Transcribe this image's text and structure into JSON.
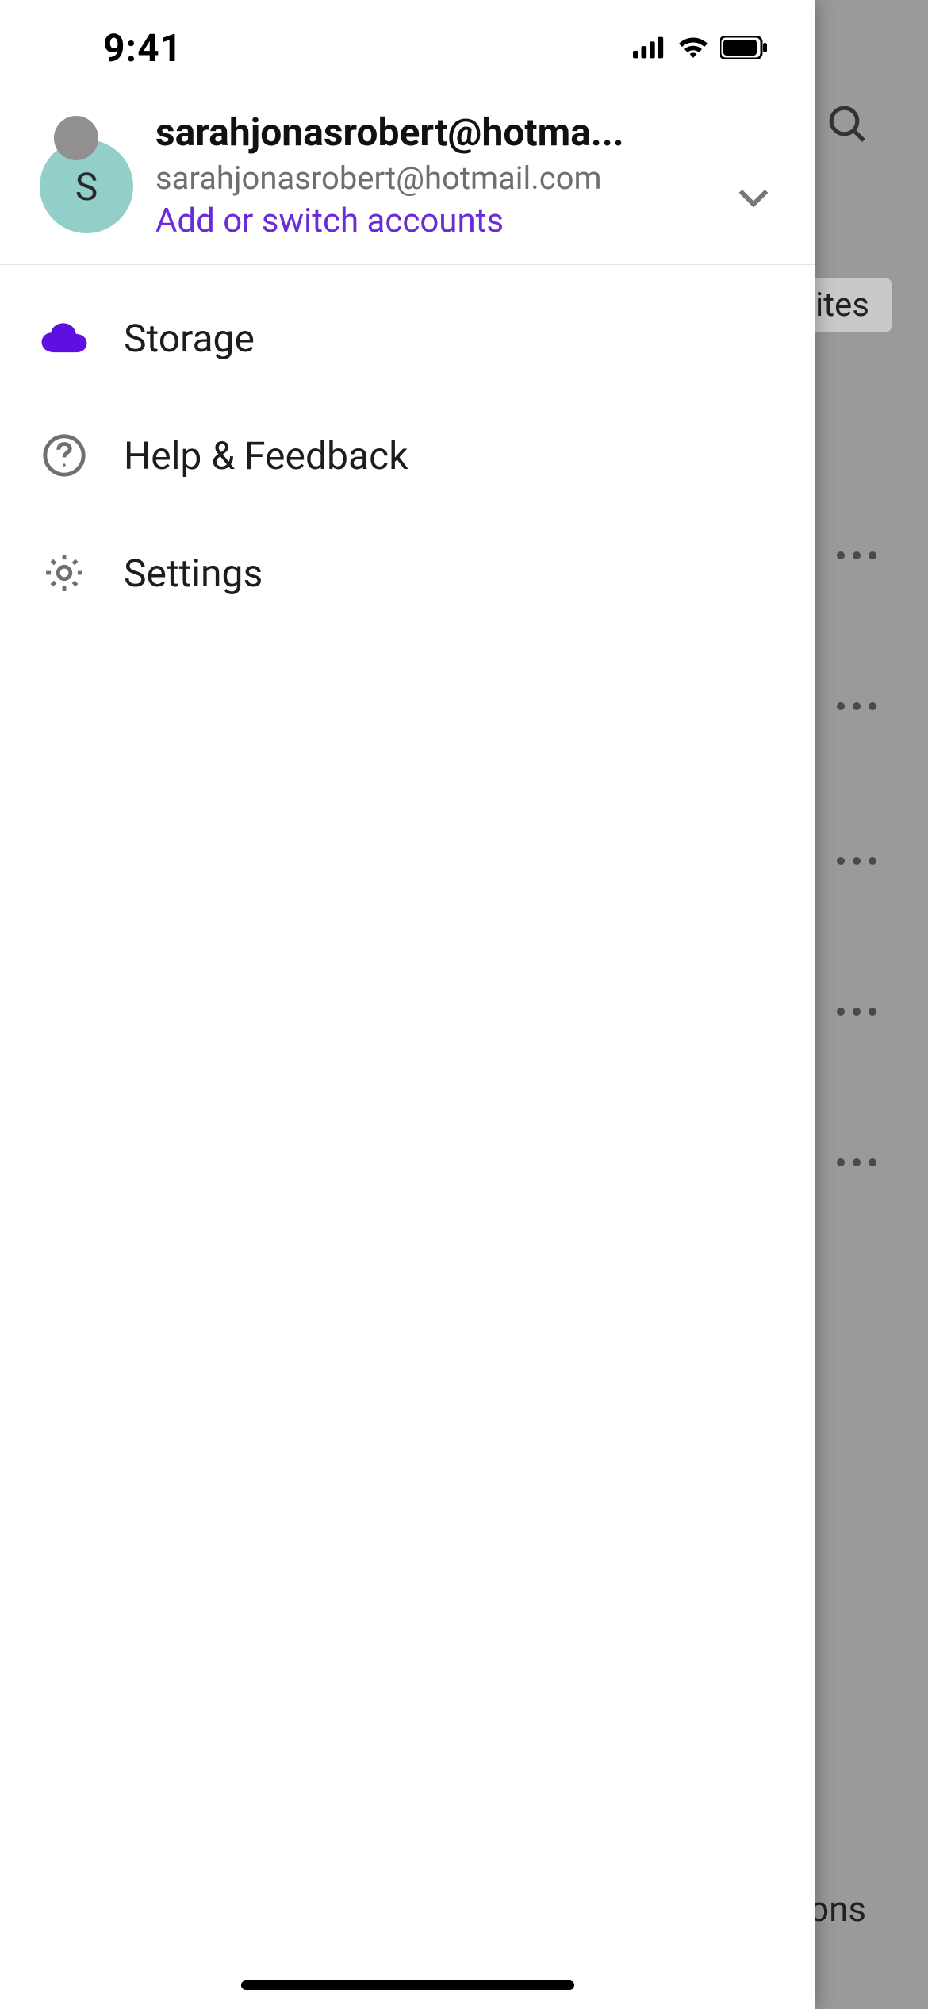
{
  "status": {
    "time": "9:41",
    "cellular_bars": 4,
    "wifi": true,
    "battery_pct": 95
  },
  "drawer": {
    "account": {
      "avatar_letter": "S",
      "display_name": "sarahjonasrobert@hotmail.com",
      "display_name_truncated": "sarahjonasrobert@hotma...",
      "email": "sarahjonasrobert@hotmail.com",
      "add_switch_label": "Add or switch accounts"
    },
    "menu": [
      {
        "id": "storage",
        "label": "Storage",
        "icon": "cloud-icon",
        "icon_color": "#5f10e0"
      },
      {
        "id": "help",
        "label": "Help & Feedback",
        "icon": "help-circle-icon",
        "icon_color": "#6f6f6f"
      },
      {
        "id": "settings",
        "label": "Settings",
        "icon": "gear-icon",
        "icon_color": "#6f6f6f"
      }
    ]
  },
  "background": {
    "search_icon": "search-icon",
    "tab_partial_text": "ites",
    "bottom_partial_text": "ons",
    "more_rows": 5
  }
}
